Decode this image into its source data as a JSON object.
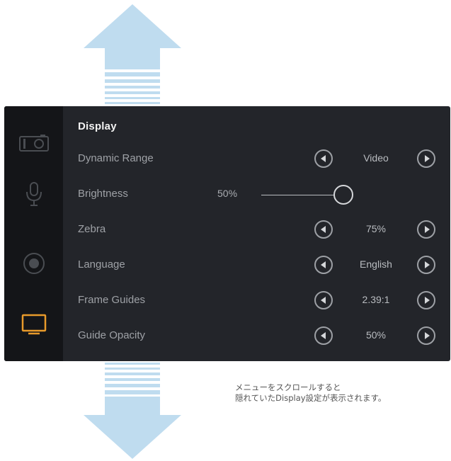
{
  "panel": {
    "title": "Display",
    "sidebar": [
      {
        "icon": "camera-icon",
        "active": false
      },
      {
        "icon": "microphone-icon",
        "active": false
      },
      {
        "icon": "record-icon",
        "active": false
      },
      {
        "icon": "monitor-icon",
        "active": true
      }
    ],
    "rows": [
      {
        "label": "Dynamic Range",
        "value": "Video"
      },
      {
        "label": "Brightness",
        "value": "50%",
        "level": 1.0
      },
      {
        "label": "Zebra",
        "value": "75%"
      },
      {
        "label": "Language",
        "value": "English"
      },
      {
        "label": "Frame Guides",
        "value": "2.39:1"
      },
      {
        "label": "Guide Opacity",
        "value": "50%"
      }
    ]
  },
  "caption": {
    "line1": "メニューをスクロールすると",
    "line2": "隠れていたDisplay設定が表示されます。"
  },
  "colors": {
    "arrow": "#bfdcef",
    "panel_bg": "#23252a",
    "sidebar_bg": "#141518",
    "active_icon": "#e89a2b"
  }
}
